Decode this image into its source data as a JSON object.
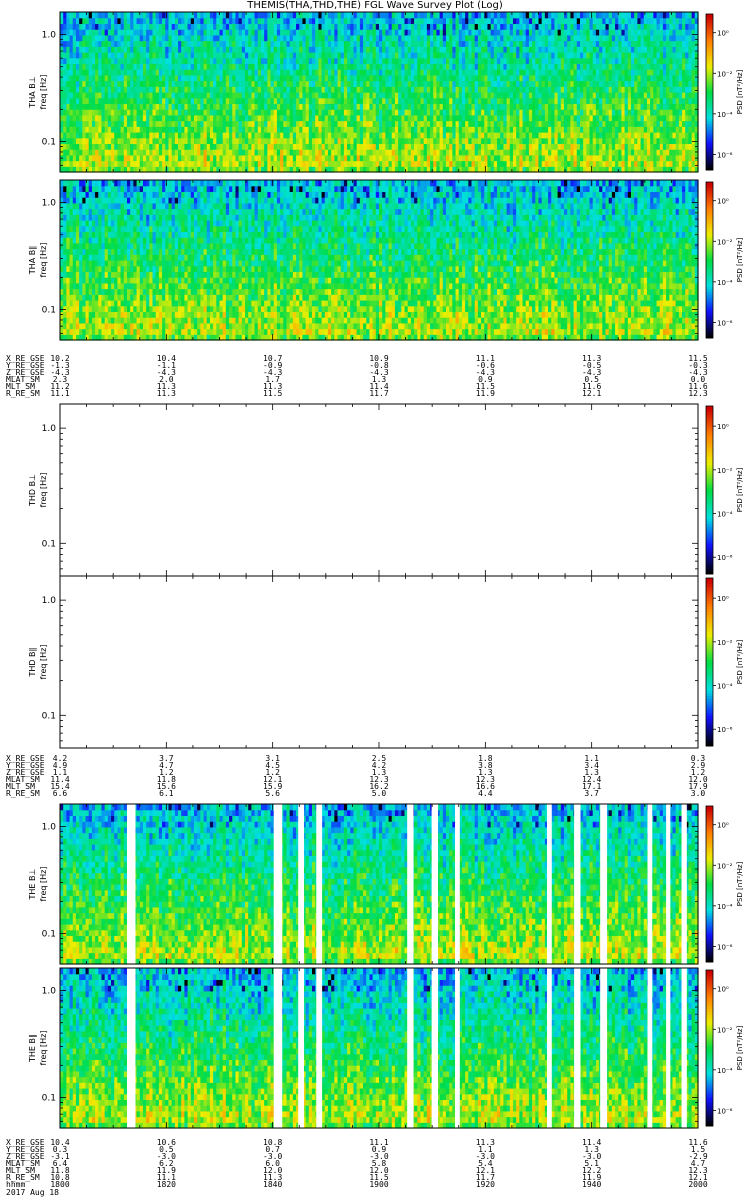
{
  "title": "THEMIS(THA,THD,THE) FGL Wave Survey Plot (Log)",
  "date": "2017 Aug 18",
  "chart_data": {
    "type": "heatmap",
    "x_time_range": [
      "1800",
      "2000"
    ],
    "y_scale": "log",
    "y_ticks": [
      "1.0",
      "0.1"
    ],
    "colorbar_label": "PSD [nT²/Hz]",
    "colorbar_ticks": [
      "10⁰",
      "10⁻²",
      "10⁻⁴",
      "10⁻⁶"
    ],
    "colorscale": [
      "#000000",
      "#1010ff",
      "#00e0e0",
      "#00dd44",
      "#eeee00",
      "#ff7f00",
      "#cc0000"
    ],
    "panels": [
      {
        "probe": "THA",
        "component": "THA B⊥",
        "ylabel": "freq [Hz]",
        "has_data": true,
        "seed": 11,
        "gaps": []
      },
      {
        "probe": "THA",
        "component": "THA B∥",
        "ylabel": "freq [Hz]",
        "has_data": true,
        "seed": 23,
        "gaps": []
      },
      {
        "probe": "THD",
        "component": "THD B⊥",
        "ylabel": "freq [Hz]",
        "has_data": false
      },
      {
        "probe": "THD",
        "component": "THD B∥",
        "ylabel": "freq [Hz]",
        "has_data": false
      },
      {
        "probe": "THE",
        "component": "THE B⊥",
        "ylabel": "freq [Hz]",
        "has_data": true,
        "seed": 37,
        "gaps": [
          [
            "1812.6",
            "1814.2"
          ],
          [
            "1840.2",
            "1841.8"
          ],
          [
            "1844.8",
            "1845.9"
          ],
          [
            "1848.2",
            "1849.3"
          ],
          [
            "1905.3",
            "1906.5"
          ],
          [
            "1909.9",
            "1911.1"
          ],
          [
            "1914.3",
            "1915.2"
          ],
          [
            "1931.6",
            "1932.5"
          ],
          [
            "1936.7",
            "1937.9"
          ],
          [
            "1941.6",
            "1942.9"
          ],
          [
            "1950.5",
            "1951.4"
          ],
          [
            "1954.0",
            "1954.8"
          ],
          [
            "1956.9",
            "1957.9"
          ]
        ]
      },
      {
        "probe": "THE",
        "component": "THE B∥",
        "ylabel": "freq [Hz]",
        "has_data": true,
        "seed": 53,
        "gaps": [
          [
            "1812.6",
            "1814.2"
          ],
          [
            "1840.2",
            "1841.8"
          ],
          [
            "1844.8",
            "1845.9"
          ],
          [
            "1848.2",
            "1849.3"
          ],
          [
            "1905.3",
            "1906.5"
          ],
          [
            "1909.9",
            "1911.1"
          ],
          [
            "1914.3",
            "1915.2"
          ],
          [
            "1931.6",
            "1932.5"
          ],
          [
            "1936.7",
            "1937.9"
          ],
          [
            "1941.6",
            "1942.9"
          ],
          [
            "1950.5",
            "1951.4"
          ],
          [
            "1954.0",
            "1954.8"
          ],
          [
            "1956.9",
            "1957.9"
          ]
        ]
      }
    ],
    "ephemeris": [
      {
        "probe": "THA",
        "rows": [
          {
            "label": "X_RE_GSE",
            "values": [
              "10.2",
              "10.4",
              "10.7",
              "10.9",
              "11.1",
              "11.3",
              "11.5"
            ]
          },
          {
            "label": "Y_RE_GSE",
            "values": [
              "-1.3",
              "-1.1",
              "-0.9",
              "-0.8",
              "-0.6",
              "-0.5",
              "-0.3"
            ]
          },
          {
            "label": "Z_RE_GSE",
            "values": [
              "-4.3",
              "-4.3",
              "-4.3",
              "-4.3",
              "-4.3",
              "-4.3",
              "-4.3"
            ]
          },
          {
            "label": "MLAT_SM",
            "values": [
              "2.3",
              "2.0",
              "1.7",
              "1.3",
              "0.9",
              "0.5",
              "0.0"
            ]
          },
          {
            "label": "MLT_SM",
            "values": [
              "11.2",
              "11.3",
              "11.3",
              "11.4",
              "11.5",
              "11.6",
              "11.6"
            ]
          },
          {
            "label": "R_RE_SM",
            "values": [
              "11.1",
              "11.3",
              "11.5",
              "11.7",
              "11.9",
              "12.1",
              "12.3"
            ]
          }
        ]
      },
      {
        "probe": "THD",
        "rows": [
          {
            "label": "X_RE_GSE",
            "values": [
              "4.2",
              "3.7",
              "3.1",
              "2.5",
              "1.8",
              "1.1",
              "0.3"
            ]
          },
          {
            "label": "Y_RE_GSE",
            "values": [
              "4.9",
              "4.7",
              "4.5",
              "4.2",
              "3.8",
              "3.4",
              "2.9"
            ]
          },
          {
            "label": "Z_RE_GSE",
            "values": [
              "1.1",
              "1.2",
              "1.2",
              "1.3",
              "1.3",
              "1.3",
              "1.2"
            ]
          },
          {
            "label": "MLAT_SM",
            "values": [
              "11.4",
              "11.8",
              "12.1",
              "12.3",
              "12.3",
              "12.4",
              "12.0"
            ]
          },
          {
            "label": "MLT_SM",
            "values": [
              "15.4",
              "15.6",
              "15.9",
              "16.2",
              "16.6",
              "17.1",
              "17.9"
            ]
          },
          {
            "label": "R_RE_SM",
            "values": [
              "6.6",
              "6.1",
              "5.6",
              "5.0",
              "4.4",
              "3.7",
              "3.0"
            ]
          }
        ]
      },
      {
        "probe": "THE",
        "rows": [
          {
            "label": "X_RE_GSE",
            "values": [
              "10.4",
              "10.6",
              "10.8",
              "11.1",
              "11.3",
              "11.4",
              "11.6"
            ]
          },
          {
            "label": "Y_RE_GSE",
            "values": [
              "0.3",
              "0.5",
              "0.7",
              "0.9",
              "1.1",
              "1.3",
              "1.5"
            ]
          },
          {
            "label": "Z_RE_GSE",
            "values": [
              "-3.1",
              "-3.0",
              "-3.0",
              "-3.0",
              "-3.0",
              "-3.0",
              "-2.9"
            ]
          },
          {
            "label": "MLAT_SM",
            "values": [
              "6.4",
              "6.2",
              "6.0",
              "5.8",
              "5.4",
              "5.1",
              "4.7"
            ]
          },
          {
            "label": "MLT_SM",
            "values": [
              "11.8",
              "11.9",
              "12.0",
              "12.0",
              "12.1",
              "12.2",
              "12.3"
            ]
          },
          {
            "label": "R_RE_SM",
            "values": [
              "10.8",
              "11.1",
              "11.3",
              "11.5",
              "11.7",
              "11.9",
              "12.1"
            ]
          },
          {
            "label": "hhmm",
            "values": [
              "1800",
              "1820",
              "1840",
              "1900",
              "1920",
              "1940",
              "2000"
            ]
          }
        ]
      }
    ]
  }
}
